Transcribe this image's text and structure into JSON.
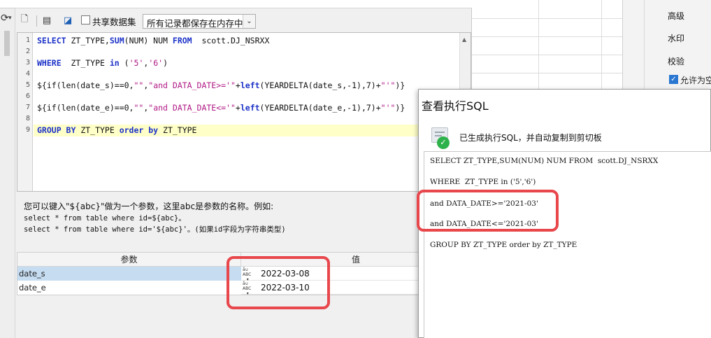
{
  "toolbar": {
    "share_label": "共享数据集",
    "memory_mode": "所有记录都保存在内存中"
  },
  "editor": {
    "lines": [
      {
        "num": "1",
        "parts": [
          {
            "t": "SELECT",
            "c": "kw"
          },
          {
            "t": " ZT_TYPE,",
            "c": ""
          },
          {
            "t": "SUM",
            "c": "kw"
          },
          {
            "t": "(NUM) NUM ",
            "c": ""
          },
          {
            "t": "FROM",
            "c": "kw"
          },
          {
            "t": "  scott.DJ_NSRXX",
            "c": ""
          }
        ]
      },
      {
        "num": "2",
        "parts": []
      },
      {
        "num": "3",
        "parts": [
          {
            "t": "WHERE",
            "c": "kw"
          },
          {
            "t": "  ZT_TYPE ",
            "c": ""
          },
          {
            "t": "in",
            "c": "kw"
          },
          {
            "t": " (",
            "c": ""
          },
          {
            "t": "'5'",
            "c": "str"
          },
          {
            "t": ",",
            "c": ""
          },
          {
            "t": "'6'",
            "c": "str"
          },
          {
            "t": ")",
            "c": ""
          }
        ]
      },
      {
        "num": "4",
        "parts": []
      },
      {
        "num": "5",
        "parts": [
          {
            "t": "${if(len(date_s)==0,",
            "c": ""
          },
          {
            "t": "\"\"",
            "c": "str"
          },
          {
            "t": ",",
            "c": ""
          },
          {
            "t": "\"and DATA_DATE>='\"",
            "c": "str"
          },
          {
            "t": "+",
            "c": ""
          },
          {
            "t": "left",
            "c": "kw"
          },
          {
            "t": "(YEARDELTA(date_s,-1),7)+",
            "c": ""
          },
          {
            "t": "\"'\"",
            "c": "str"
          },
          {
            "t": ")}",
            "c": ""
          }
        ]
      },
      {
        "num": "6",
        "parts": []
      },
      {
        "num": "7",
        "parts": [
          {
            "t": "${if(len(date_e)==0,",
            "c": ""
          },
          {
            "t": "\"\"",
            "c": "str"
          },
          {
            "t": ",",
            "c": ""
          },
          {
            "t": "\"and DATA_DATE<='\"",
            "c": "str"
          },
          {
            "t": "+",
            "c": ""
          },
          {
            "t": "left",
            "c": "kw"
          },
          {
            "t": "(YEARDELTA(date_e,-1),7)+",
            "c": ""
          },
          {
            "t": "\"'\"",
            "c": "str"
          },
          {
            "t": ")}",
            "c": ""
          }
        ]
      },
      {
        "num": "8",
        "parts": []
      },
      {
        "num": "9",
        "parts": [
          {
            "t": "GROUP BY",
            "c": "kw"
          },
          {
            "t": " ZT_TYPE ",
            "c": ""
          },
          {
            "t": "order by",
            "c": "kw"
          },
          {
            "t": " ZT_TYPE",
            "c": ""
          }
        ]
      }
    ]
  },
  "hint": {
    "line1": "您可以键入\"${abc}\"做为一个参数，这里abc是参数的名称。例如:",
    "line2": "select * from table where id=${abc}。",
    "line3": "select * from table where id='${abc}'。(如果id字段为字符串类型)"
  },
  "params": {
    "col_name": "参数",
    "col_value": "值",
    "type_icon": "abc-type-icon",
    "rows": [
      {
        "name": "date_s",
        "value": "2022-03-08"
      },
      {
        "name": "date_e",
        "value": "2022-03-10"
      }
    ]
  },
  "props_panel": {
    "advanced": "高级",
    "watermark": "水印",
    "validate": "校验",
    "allow_empty": "允许为空"
  },
  "view_sql": {
    "title": "查看执行SQL",
    "message": "已生成执行SQL，并自动复制到剪切板",
    "lines": [
      "SELECT ZT_TYPE,SUM(NUM) NUM FROM  scott.DJ_NSRXX",
      "WHERE  ZT_TYPE in ('5','6')",
      "and DATA_DATE>='2021-03'",
      "and DATA_DATE<='2021-03'",
      "GROUP BY ZT_TYPE order by ZT_TYPE"
    ]
  },
  "colors": {
    "keyword": "#1c32c8",
    "string": "#b01a86",
    "highlight_line": "#ffffc8",
    "annotation_red": "#e8474c",
    "selected_row": "#c6dcf1"
  }
}
